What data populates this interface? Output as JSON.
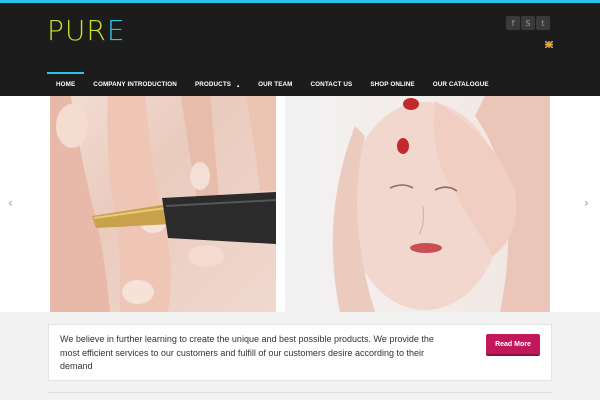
{
  "header": {
    "logo": {
      "main": "PUR",
      "accent": "E"
    },
    "social": [
      {
        "icon": "facebook-icon",
        "glyph": "f"
      },
      {
        "icon": "skype-icon",
        "glyph": "S"
      },
      {
        "icon": "twitter-icon",
        "glyph": "t"
      }
    ],
    "language_icon": "uk-flag-icon"
  },
  "nav": {
    "items": [
      {
        "label": "HOME",
        "active": true
      },
      {
        "label": "COMPANY INTRODUCTION"
      },
      {
        "label": "PRODUCTS",
        "caret": "▲"
      },
      {
        "label": "OUR TEAM"
      },
      {
        "label": "CONTACT US"
      },
      {
        "label": "SHOP ONLINE"
      },
      {
        "label": "OUR CATALOGUE"
      }
    ]
  },
  "slider": {
    "prev": "‹",
    "next": "›"
  },
  "info": {
    "text": "We believe in further learning to create the unique and best possible products. We provide the most efficient services to our customers and fulfill of our customers desire according to their demand",
    "button": "Read More"
  },
  "colors": {
    "accent": "#2cc3e8",
    "logo": "#c8e02a",
    "button": "#c2185b",
    "header_bg": "#1c1c1c"
  }
}
